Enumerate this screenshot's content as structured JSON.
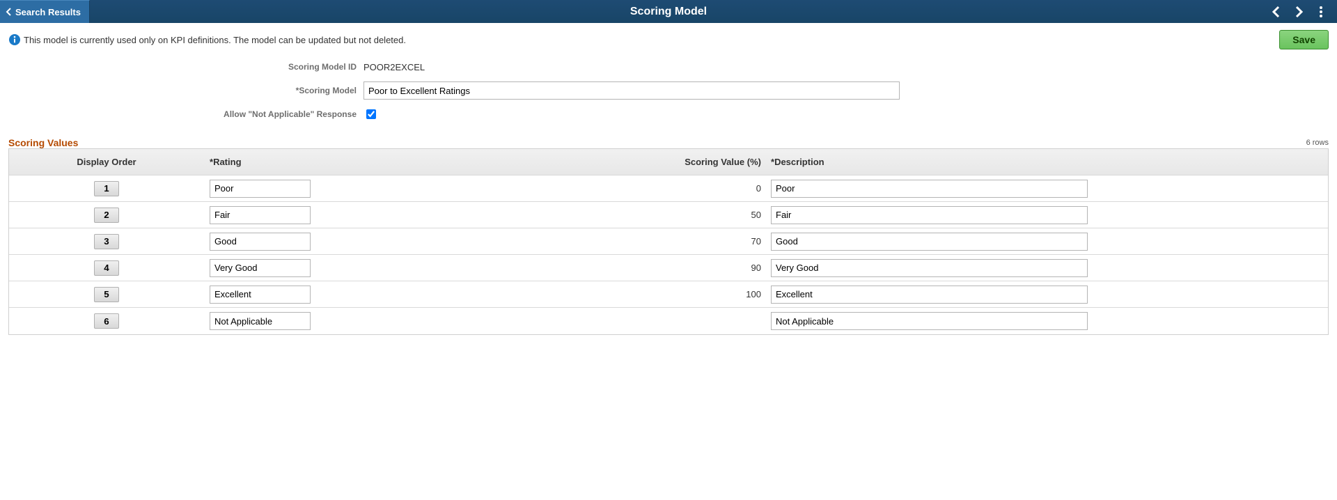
{
  "header": {
    "back_label": "Search Results",
    "title": "Scoring Model"
  },
  "info_message": "This model is currently used only on KPI definitions. The model can be updated but not deleted.",
  "buttons": {
    "save": "Save"
  },
  "form": {
    "labels": {
      "model_id": "Scoring Model ID",
      "model_name": "Scoring Model",
      "allow_na": "Allow \"Not Applicable\" Response"
    },
    "values": {
      "model_id": "POOR2EXCEL",
      "model_name": "Poor to Excellent Ratings",
      "allow_na_checked": true
    }
  },
  "section_title": "Scoring Values",
  "rows_label": "6 rows",
  "grid": {
    "headers": {
      "display_order": "Display Order",
      "rating": "Rating",
      "scoring_value": "Scoring Value (%)",
      "description": "Description"
    },
    "rows": [
      {
        "order": "1",
        "rating": "Poor",
        "value": "0",
        "description": "Poor"
      },
      {
        "order": "2",
        "rating": "Fair",
        "value": "50",
        "description": "Fair"
      },
      {
        "order": "3",
        "rating": "Good",
        "value": "70",
        "description": "Good"
      },
      {
        "order": "4",
        "rating": "Very Good",
        "value": "90",
        "description": "Very Good"
      },
      {
        "order": "5",
        "rating": "Excellent",
        "value": "100",
        "description": "Excellent"
      },
      {
        "order": "6",
        "rating": "Not Applicable",
        "value": "",
        "description": "Not Applicable"
      }
    ]
  }
}
